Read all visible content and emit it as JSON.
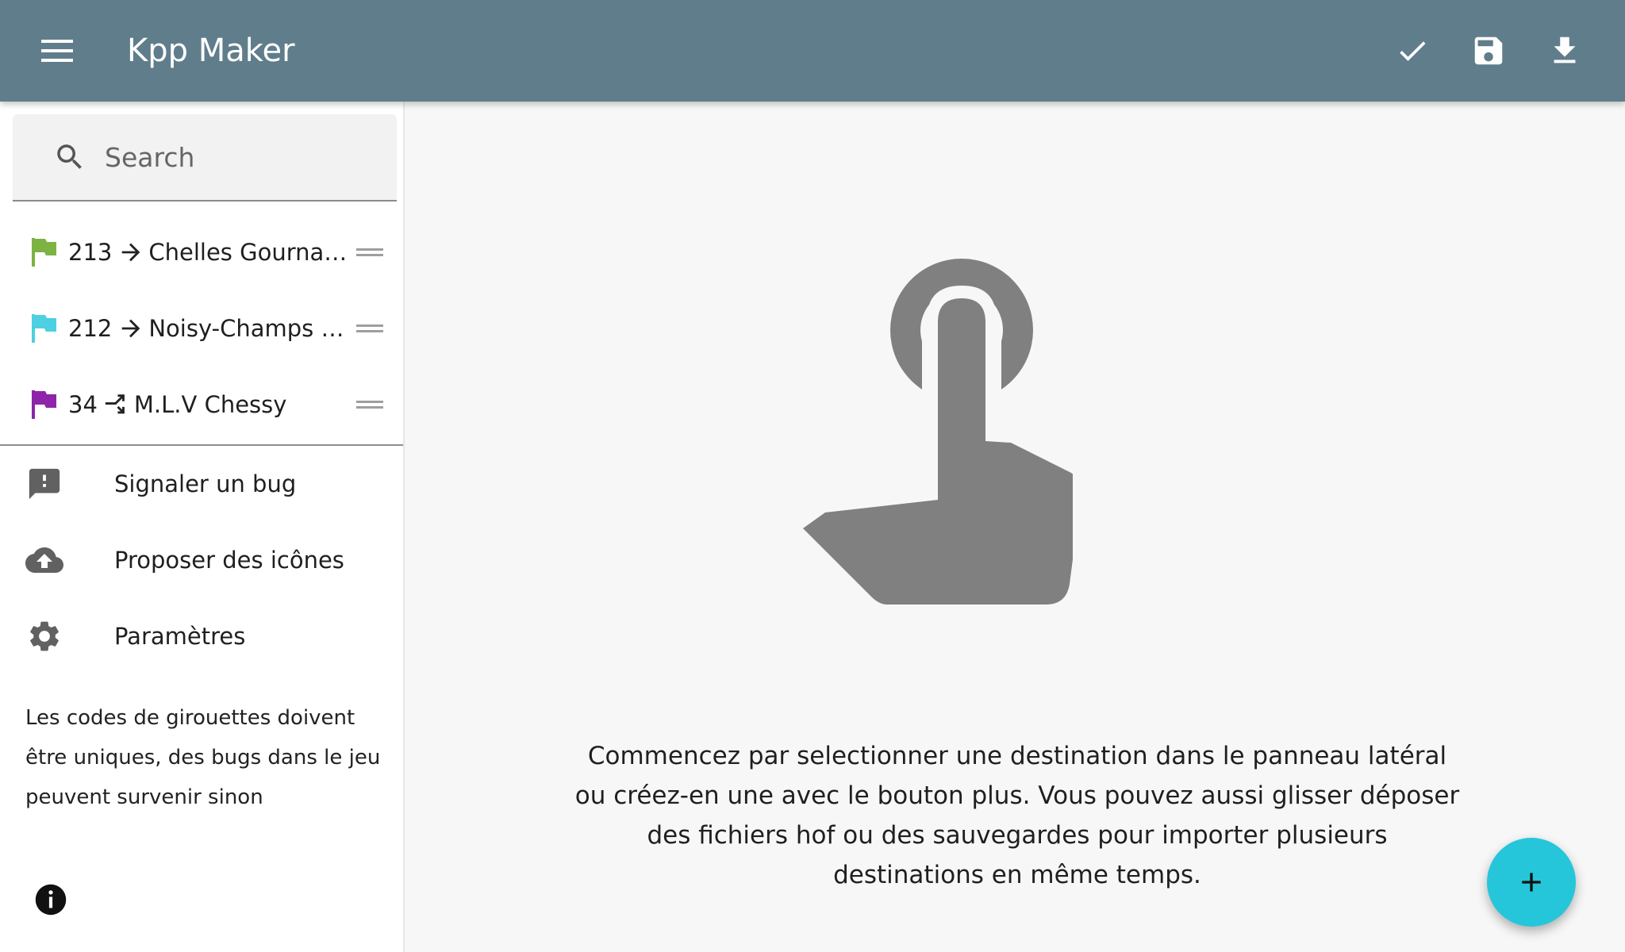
{
  "app": {
    "title": "Kpp Maker",
    "primary_color": "#607d8b",
    "accent_color": "#26c6da"
  },
  "topbar": {
    "menu_icon": "menu-icon",
    "actions": [
      {
        "icon": "check-icon"
      },
      {
        "icon": "save-icon"
      },
      {
        "icon": "download-icon"
      }
    ]
  },
  "search": {
    "placeholder": "Search",
    "value": ""
  },
  "destinations": [
    {
      "code": "213",
      "flag_color": "#7cb342",
      "direction": "arrow-right-icon",
      "name": "Chelles Gournay Gare"
    },
    {
      "code": "212",
      "flag_color": "#4dd0e1",
      "direction": "arrow-right-icon",
      "name": "Noisy-Champs RER"
    },
    {
      "code": "34",
      "flag_color": "#8e24aa",
      "direction": "shuffle-icon",
      "name": "M.L.V Chessy"
    }
  ],
  "menu": [
    {
      "icon": "report-bug-icon",
      "label": "Signaler un bug"
    },
    {
      "icon": "cloud-upload-icon",
      "label": "Proposer des icônes"
    },
    {
      "icon": "settings-icon",
      "label": "Paramètres"
    }
  ],
  "sidebar_note": "Les codes de girouettes doivent être uniques, des bugs dans le jeu peuvent survenir sinon",
  "main": {
    "illustration_icon": "touch-app-icon",
    "hint": "Commencez par selectionner une destination dans le panneau latéral ou créez-en une avec le bouton plus. Vous pouvez aussi glisser déposer des fichiers hof ou des sauvegardes pour importer plusieurs destinations en même temps."
  },
  "fab": {
    "icon": "add-icon"
  }
}
